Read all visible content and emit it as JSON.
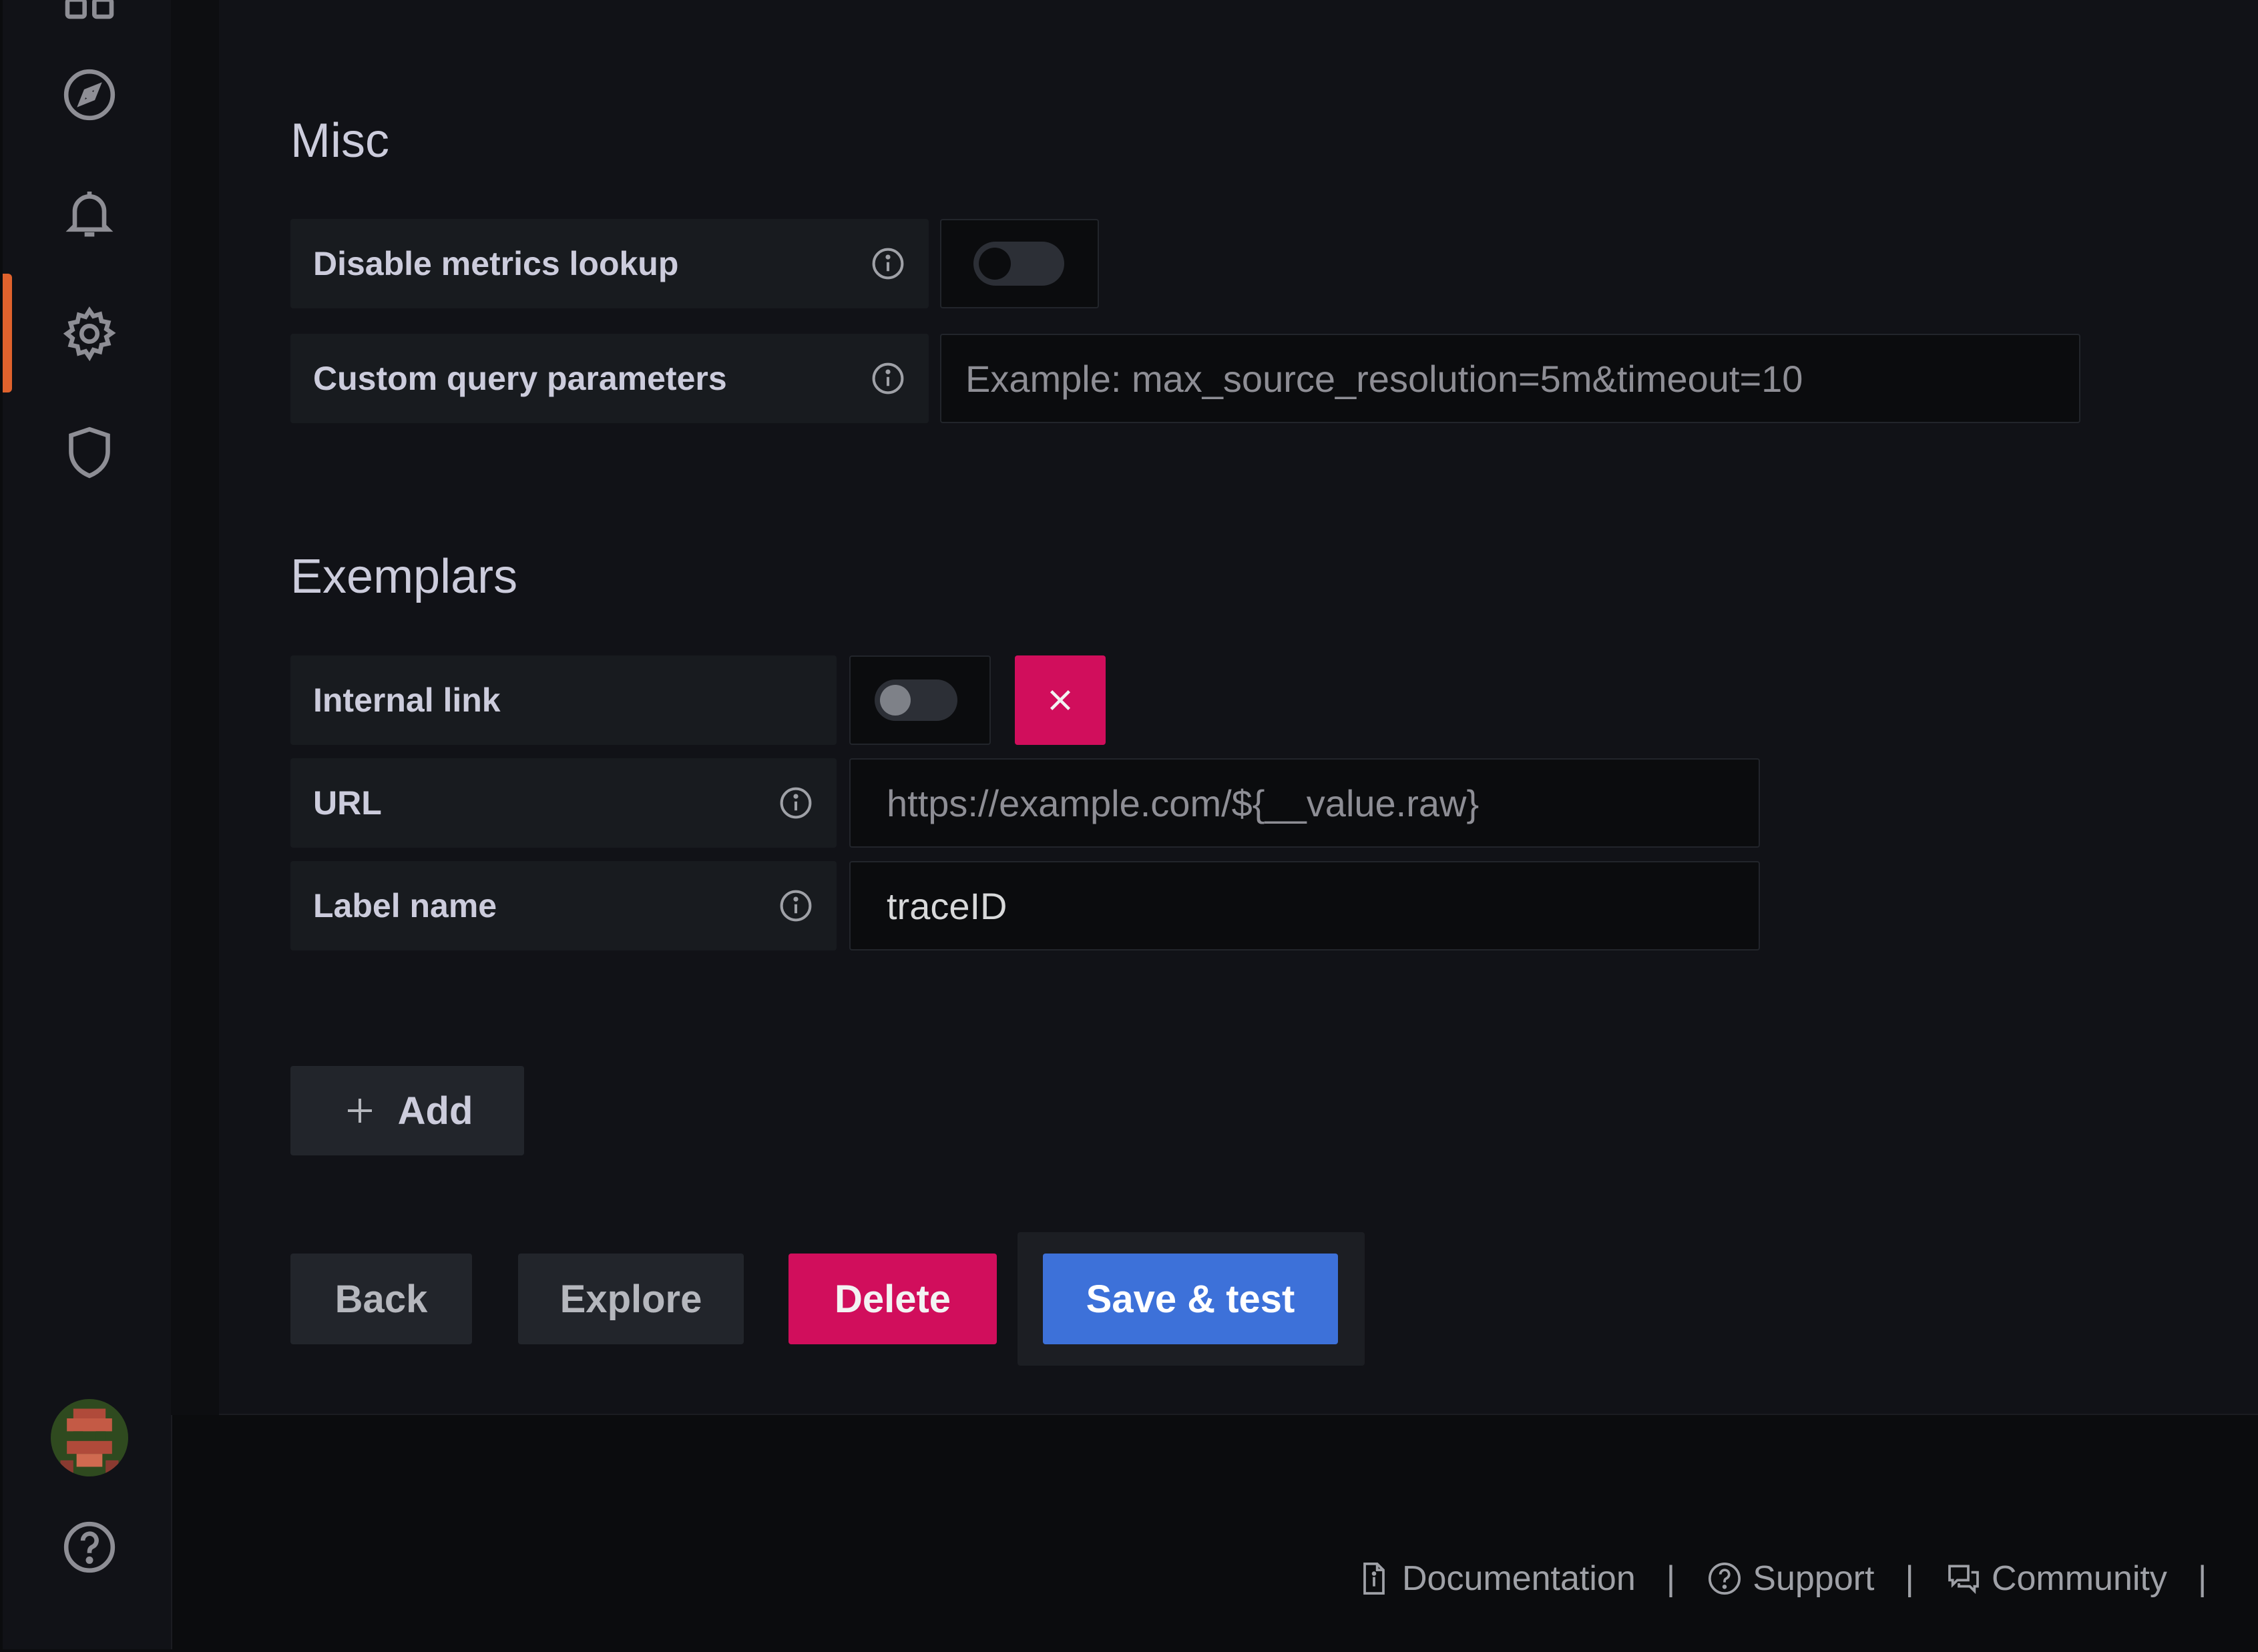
{
  "misc": {
    "title": "Misc",
    "disable_metrics_lookup": {
      "label": "Disable metrics lookup",
      "enabled": false
    },
    "custom_query_parameters": {
      "label": "Custom query parameters",
      "placeholder": "Example: max_source_resolution=5m&timeout=10",
      "value": ""
    }
  },
  "exemplars": {
    "title": "Exemplars",
    "internal_link": {
      "label": "Internal link",
      "enabled": false
    },
    "url": {
      "label": "URL",
      "placeholder": "https://example.com/${__value.raw}",
      "value": ""
    },
    "label_name": {
      "label": "Label name",
      "value": "traceID"
    },
    "add_label": "Add"
  },
  "actions": {
    "back": "Back",
    "explore": "Explore",
    "delete": "Delete",
    "save_test": "Save & test"
  },
  "footer": {
    "documentation": "Documentation",
    "support": "Support",
    "community": "Community",
    "separator": "|"
  },
  "colors": {
    "accent_active": "#e0622d",
    "danger": "#d10e5c",
    "primary": "#3d71d9"
  },
  "icons": [
    "dashboard-icon",
    "explore-compass-icon",
    "alert-bell-icon",
    "settings-gear-icon",
    "shield-icon",
    "user-avatar",
    "help-icon",
    "info-icon",
    "close-icon",
    "plus-icon",
    "document-icon",
    "question-circle-icon",
    "chat-bubbles-icon"
  ]
}
